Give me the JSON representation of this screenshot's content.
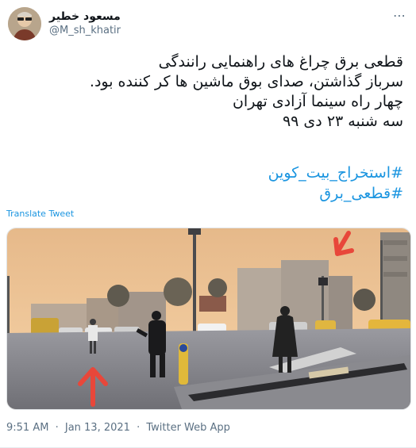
{
  "author": {
    "name": "مسعود خطیر",
    "handle": "@M_sh_khatir"
  },
  "menu_icon": "more-dots-icon",
  "tweet": {
    "lines": [
      "قطعی برق چراغ های راهنمایی رانندگی",
      "سرباز گذاشتن، صدای بوق ماشین ها کر کننده بود.",
      "چهار راه سینما آزادی تهران",
      "سه شنبه ۲۳ دی ۹۹"
    ],
    "hashtags": [
      "#استخراج_بیت_کوین",
      "#قطعی_برق"
    ]
  },
  "translate_label": "Translate Tweet",
  "footer": {
    "time": "9:51 AM",
    "sep1": "·",
    "date": "Jan 13, 2021",
    "sep2": "·",
    "source": "Twitter Web App"
  },
  "colors": {
    "link": "#1b95e0",
    "muted": "#5b7083",
    "arrow": "#e8473a"
  }
}
